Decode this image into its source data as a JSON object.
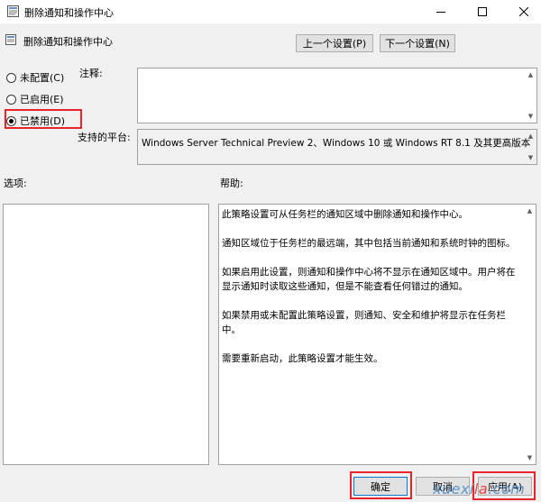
{
  "window": {
    "title": "删除通知和操作中心"
  },
  "header": {
    "policy_title": "删除通知和操作中心",
    "prev_button": "上一个设置(P)",
    "next_button": "下一个设置(N)"
  },
  "state": {
    "options": [
      {
        "label": "未配置(C)",
        "selected": false
      },
      {
        "label": "已启用(E)",
        "selected": false
      },
      {
        "label": "已禁用(D)",
        "selected": true
      }
    ]
  },
  "comment": {
    "label": "注释:",
    "value": ""
  },
  "platform": {
    "label": "支持的平台:",
    "value": "Windows Server Technical Preview 2、Windows 10 或 Windows RT 8.1 及其更高版本"
  },
  "options_panel": {
    "label": "选项:"
  },
  "help_panel": {
    "label": "帮助:",
    "paragraphs": [
      "此策略设置可从任务栏的通知区域中删除通知和操作中心。",
      "通知区域位于任务栏的最远端，其中包括当前通知和系统时钟的图标。",
      "如果启用此设置，则通知和操作中心将不显示在通知区域中。用户将在显示通知时读取这些通知，但是不能查看任何错过的通知。",
      "如果禁用或未配置此策略设置，则通知、安全和维护将显示在任务栏中。",
      "需要重新启动，此策略设置才能生效。"
    ]
  },
  "footer": {
    "ok": "确定",
    "cancel": "取消",
    "apply": "应用(A)"
  },
  "watermark": {
    "part1": "xuexi",
    "part2": "la",
    "part3": ".com"
  },
  "colors": {
    "highlight": "#e8242b",
    "watermark_blue": "#5c95ce",
    "watermark_red": "#e64646",
    "focus": "#0078d7"
  }
}
